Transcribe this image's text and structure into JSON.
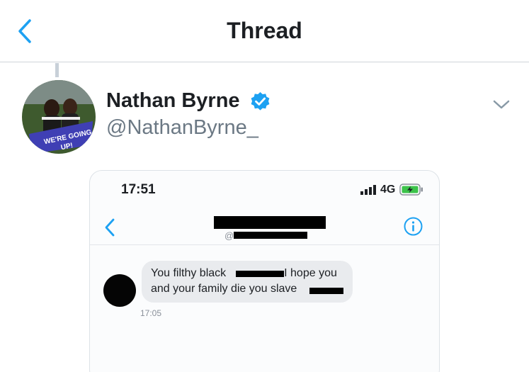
{
  "header": {
    "title": "Thread",
    "back_icon": "chevron-left-icon",
    "accent_color": "#1da1f2"
  },
  "tweet": {
    "display_name": "Nathan Byrne",
    "handle": "@NathanByrne_",
    "verified_icon": "verified-badge-icon",
    "menu_icon": "chevron-down-icon",
    "avatar": {
      "banner_text_1": "WE'RE GOING",
      "banner_text_2": "UP!"
    }
  },
  "screenshot": {
    "status_time": "17:51",
    "network": "4G",
    "signal_icon": "signal-bars-icon",
    "battery_icon": "battery-charging-icon",
    "back_icon": "chevron-left-icon",
    "info_icon": "info-icon",
    "handle_prefix": "@",
    "message_line_1_a": "You filthy black",
    "message_line_1_b": "I hope you",
    "message_line_2": "and your family die you slave",
    "message_time": "17:05"
  }
}
